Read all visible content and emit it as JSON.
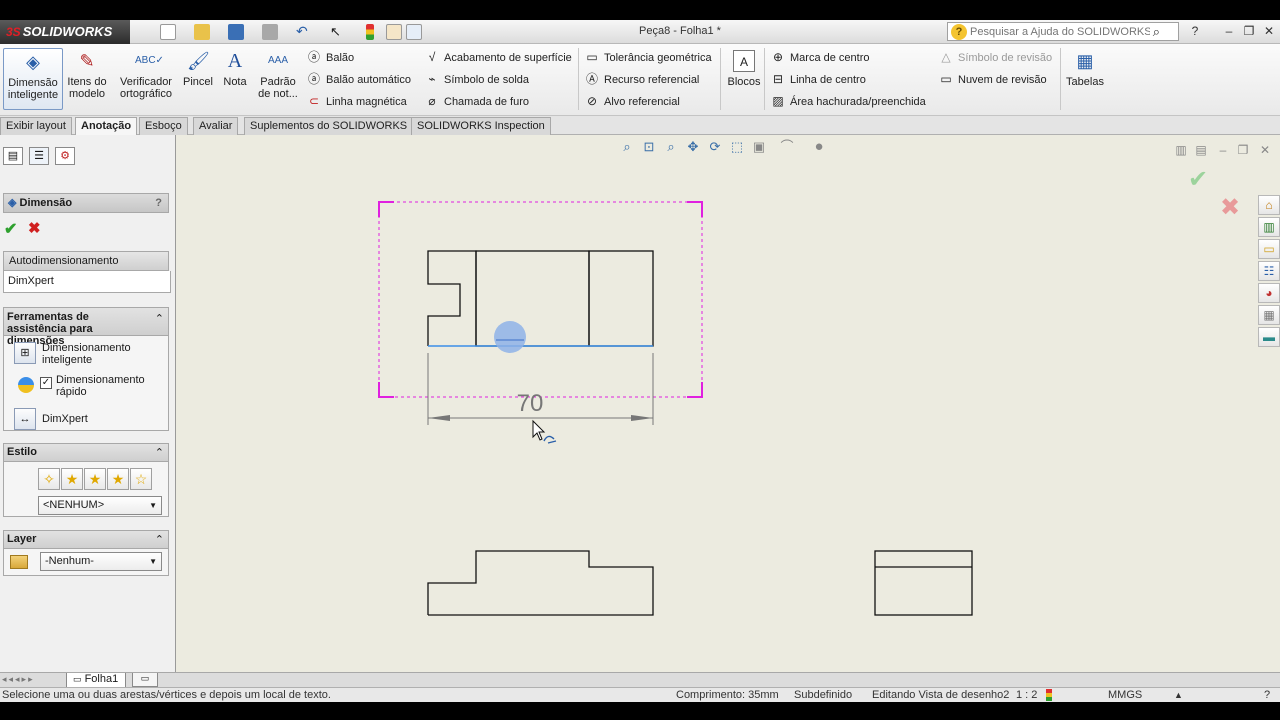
{
  "app": {
    "logo": "SOLIDWORKS",
    "title": "Peça8 - Folha1 *",
    "help_search_placeholder": "Pesquisar a Ajuda do SOLIDWORKS"
  },
  "ribbon": {
    "smart_dimension": "Dimensão inteligente",
    "model_items": "Itens do modelo",
    "spell_checker": "Verificador ortográfico",
    "format_painter": "Pincel",
    "note": "Nota",
    "linear_pattern": "Padrão de not...",
    "balloon": "Balão",
    "auto_balloon": "Balão automático",
    "magnetic_line": "Linha magnética",
    "surface_finish": "Acabamento de superfície",
    "weld_symbol": "Símbolo de solda",
    "hole_callout": "Chamada de furo",
    "geometric_tolerance": "Tolerância geométrica",
    "datum_feature": "Recurso referencial",
    "datum_target": "Alvo referencial",
    "blocks": "Blocos",
    "center_mark": "Marca de centro",
    "centerline": "Linha de centro",
    "area_hatch": "Área hachurada/preenchida",
    "revision_symbol": "Símbolo de revisão",
    "revision_cloud": "Nuvem de revisão",
    "tables": "Tabelas"
  },
  "tabs": [
    "Exibir layout",
    "Anotação",
    "Esboço",
    "Avaliar",
    "Suplementos do SOLIDWORKS",
    "SOLIDWORKS Inspection"
  ],
  "property_manager": {
    "title": "Dimensão",
    "help": "?",
    "tab_autodim": "Autodimensionamento",
    "tab_dimxpert": "DimXpert",
    "tools_header": "Ferramentas de assistência para dimensões",
    "tool_smart": "Dimensionamento inteligente",
    "tool_rapid": "Dimensionamento rápido",
    "tool_dimxpert": "DimXpert",
    "style_header": "Estilo",
    "style_value": "<NENHUM>",
    "layer_header": "Layer",
    "layer_value": "-Nenhum-"
  },
  "drawing": {
    "dimension_value": "70"
  },
  "sheet_tab": "Folha1",
  "status": {
    "hint": "Selecione uma ou duas arestas/vértices e depois um local de texto.",
    "length": "Comprimento: 35mm",
    "state": "Subdefinido",
    "editing": "Editando Vista de desenho2",
    "scale": "1 : 2",
    "units": "MMGS"
  },
  "colors": {
    "view_boundary": "#e020e0",
    "selected_edge": "#3b8ee8",
    "canvas_bg": "#ecebe0",
    "ok_green": "#2ea02e",
    "cancel_red": "#d02020"
  }
}
